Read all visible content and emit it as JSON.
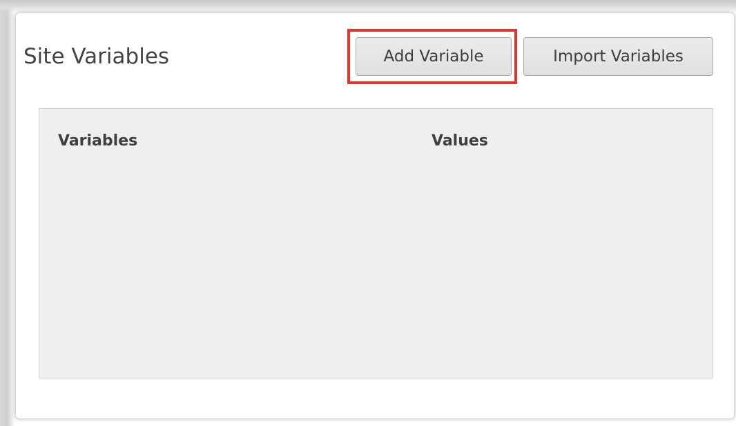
{
  "panel": {
    "title": "Site Variables"
  },
  "toolbar": {
    "add_label": "Add Variable",
    "import_label": "Import Variables"
  },
  "table": {
    "columns": [
      "Variables",
      "Values"
    ],
    "rows": []
  },
  "colors": {
    "highlight": "#e0362a",
    "table_background": "#efefef"
  }
}
